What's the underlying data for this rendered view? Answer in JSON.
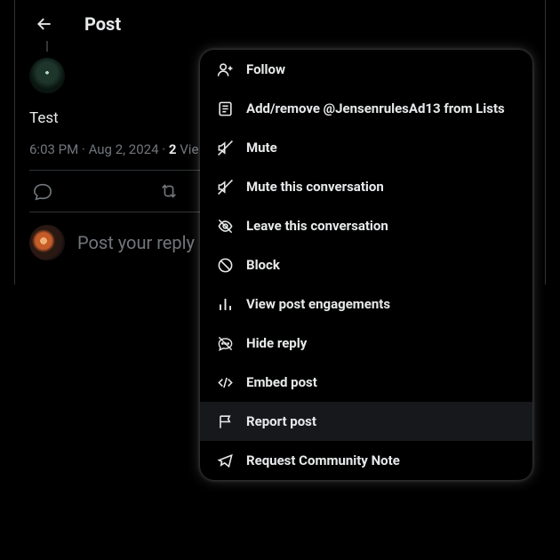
{
  "header": {
    "title": "Post"
  },
  "post": {
    "text": "Test",
    "time": "6:03 PM",
    "date": "Aug 2, 2024",
    "views_count": "2",
    "views_label_partial": "Vie"
  },
  "reply": {
    "placeholder": "Post your reply"
  },
  "menu": {
    "items": [
      {
        "icon": "follow-icon",
        "label": "Follow"
      },
      {
        "icon": "list-icon",
        "label": "Add/remove @JensenrulesAd13 from Lists"
      },
      {
        "icon": "mute-icon",
        "label": "Mute"
      },
      {
        "icon": "mute-conversation-icon",
        "label": "Mute this conversation"
      },
      {
        "icon": "leave-conversation-icon",
        "label": "Leave this conversation"
      },
      {
        "icon": "block-icon",
        "label": "Block"
      },
      {
        "icon": "engagements-icon",
        "label": "View post engagements"
      },
      {
        "icon": "hide-reply-icon",
        "label": "Hide reply"
      },
      {
        "icon": "embed-icon",
        "label": "Embed post"
      },
      {
        "icon": "report-icon",
        "label": "Report post",
        "hovered": true
      },
      {
        "icon": "community-note-icon",
        "label": "Request Community Note"
      }
    ]
  }
}
